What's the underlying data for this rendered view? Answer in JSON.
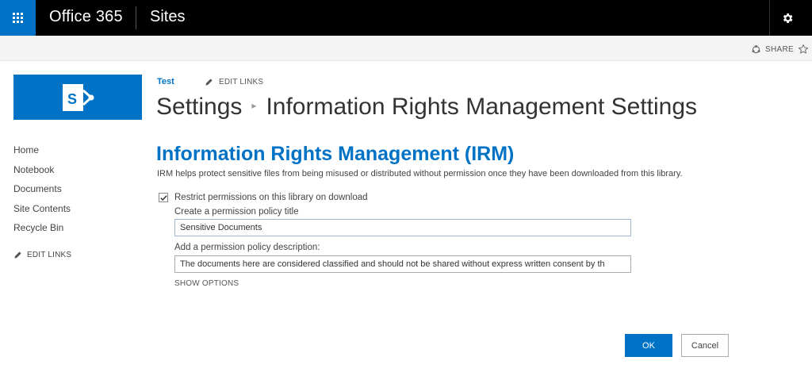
{
  "suite_bar": {
    "brand": "Office 365",
    "app_name": "Sites",
    "accent": "#0072c6"
  },
  "ribbon": {
    "share_label": "SHARE"
  },
  "quick_launch": {
    "items": [
      "Home",
      "Notebook",
      "Documents",
      "Site Contents",
      "Recycle Bin"
    ],
    "edit_links": "EDIT LINKS"
  },
  "top_nav": {
    "site": "Test",
    "edit_links": "EDIT LINKS"
  },
  "page": {
    "breadcrumb_root": "Settings",
    "breadcrumb_current": "Information Rights Management Settings"
  },
  "irm": {
    "title": "Information Rights Management (IRM)",
    "description": "IRM helps protect sensitive files from being misused or distributed without permission once they have been downloaded from this library.",
    "restrict_label": "Restrict permissions on this library on download",
    "restrict_checked": true,
    "policy_title_label": "Create a permission policy title",
    "policy_title_value": "Sensitive Documents",
    "policy_desc_label": "Add a permission policy description:",
    "policy_desc_value": "The documents here are considered classified and should not be shared without express written consent by th",
    "show_options": "SHOW OPTIONS"
  },
  "actions": {
    "ok": "OK",
    "cancel": "Cancel"
  },
  "icons": {
    "app_launcher": "waffle-icon",
    "settings": "gear-icon",
    "share": "share-icon",
    "follow": "star-icon",
    "edit": "pencil-icon",
    "site_logo": "sharepoint-logo-icon"
  }
}
